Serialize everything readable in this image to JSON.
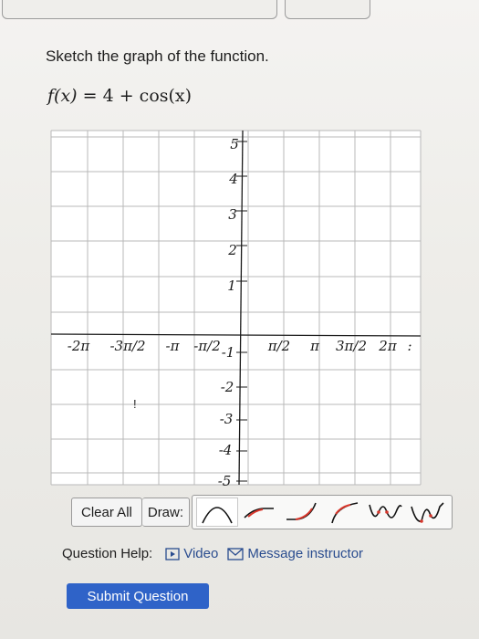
{
  "prompt": "Sketch the graph of the function.",
  "formula": {
    "lhs": "f(x)",
    "equals": "=",
    "rhs": "4 + cos(x)"
  },
  "graph": {
    "x_tick_labels": [
      "-2π",
      "-3π/2",
      "-π",
      "-π/2",
      "π/2",
      "π",
      "3π/2",
      "2π"
    ],
    "y_tick_labels_pos": [
      "5",
      "4",
      "3",
      "2",
      "1"
    ],
    "y_tick_labels_neg": [
      "-1",
      "-2",
      "-3",
      "-4",
      "-5"
    ],
    "overflow_mark": ":",
    "stray_mark": "!"
  },
  "toolbar": {
    "clear_label": "Clear All",
    "draw_label": "Draw:",
    "tools": [
      "parabola-tool",
      "curve-tool",
      "sqrt-tool",
      "log-tool",
      "sine-tool",
      "cosine-tool"
    ],
    "accent_color": "#d8362b"
  },
  "help": {
    "label": "Question Help:",
    "video_label": "Video",
    "message_label": "Message instructor",
    "link_color": "#2a4d8f"
  },
  "submit_label": "Submit Question",
  "submit_color": "#2f63c8"
}
